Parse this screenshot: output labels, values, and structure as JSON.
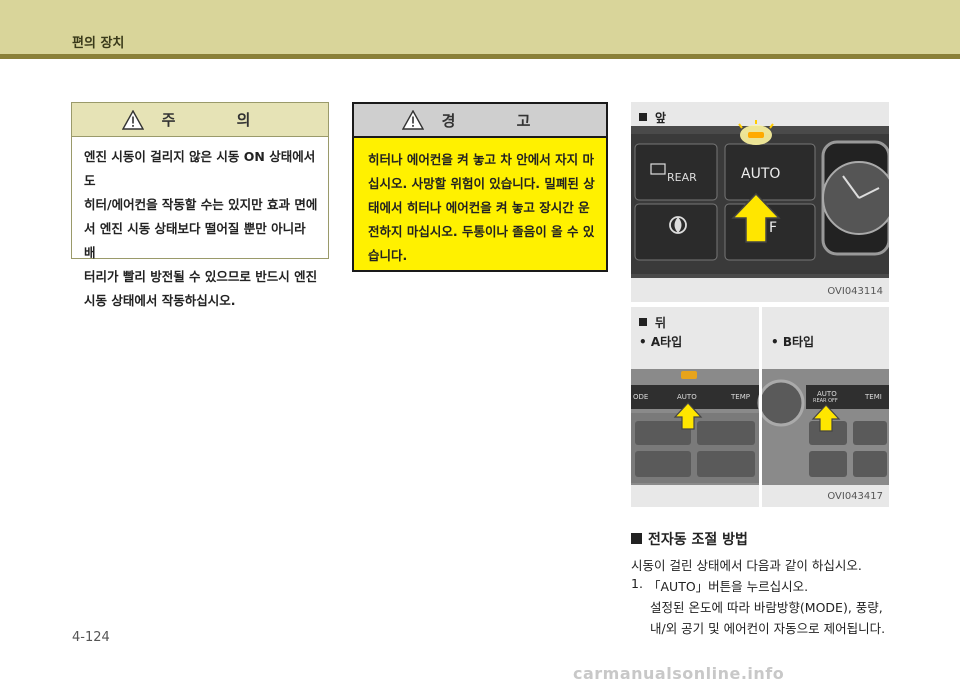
{
  "header": {
    "title": "편의 장치"
  },
  "caution": {
    "title": "주 의",
    "lines": [
      "엔진 시동이 걸리지 않은 시동 ON 상태에서도",
      "히터/에어컨을 작동할 수는 있지만 효과 면에",
      "서 엔진 시동 상태보다 떨어질 뿐만 아니라 배",
      "터리가 빨리 방전될 수 있으므로 반드시 엔진",
      "시동 상태에서 작동하십시오."
    ]
  },
  "warning": {
    "title": "경 고",
    "lines": [
      "히터나 에어컨을 켜 놓고 차 안에서 자지 마",
      "십시오. 사망할 위험이 있습니다. 밀폐된 상",
      "태에서 히터나 에어컨을 켜 놓고 장시간 운",
      "전하지 마십시오. 두통이나 졸음이 올 수 있",
      "습니다."
    ]
  },
  "photo_front": {
    "label": "앞",
    "code": "OVI043114",
    "buttons": {
      "rear": "REAR",
      "auto": "AUTO",
      "f": "F"
    }
  },
  "photo_rear": {
    "label": "뒤",
    "type_a": "A타입",
    "type_b": "B타입",
    "code": "OVI043417",
    "a_buttons": {
      "mode": "ODE",
      "auto": "AUTO",
      "temp": "TEMP"
    },
    "b_buttons": {
      "auto": "AUTO",
      "rear_off": "REAR OFF",
      "temp": "TEMI"
    }
  },
  "section": {
    "title": "전자동 조절 방법",
    "intro": "시동이 걸린 상태에서 다음과 같이 하십시오.",
    "step_number": "1.",
    "step_text": "「AUTO」버튼을 누르십시오.",
    "step_detail_1": "설정된 온도에 따라 바람방향(MODE), 풍량,",
    "step_detail_2": "내/외 공기 및 에어컨이 자동으로 제어됩니다."
  },
  "page_number": "4-124",
  "watermark": "carmanualsonline.info",
  "colors": {
    "header": "#d9d59a",
    "header_line": "#8a8038",
    "warning_bg": "#fff100",
    "arrow": "#ffe600"
  }
}
